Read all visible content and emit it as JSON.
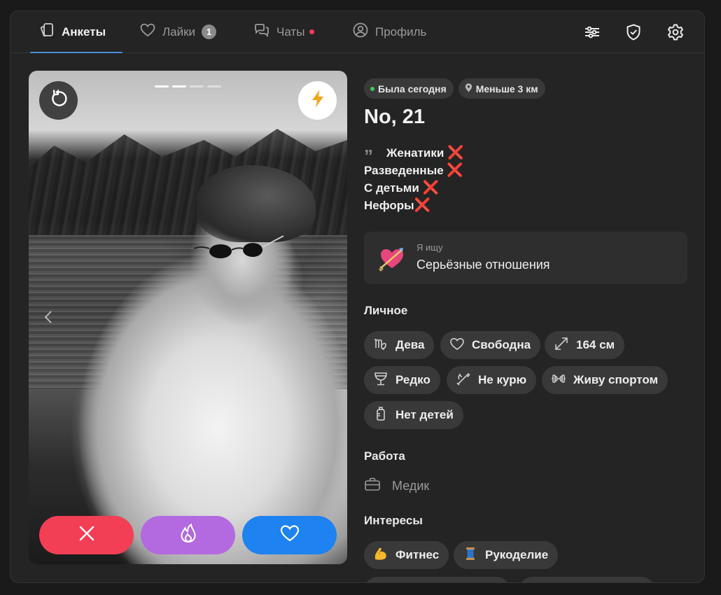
{
  "nav": {
    "tabs": [
      {
        "label": "Анкеты",
        "icon": "cards-icon",
        "active": true
      },
      {
        "label": "Лайки",
        "icon": "heart-icon",
        "badge": "1"
      },
      {
        "label": "Чаты",
        "icon": "chat-icon",
        "unread_dot": true
      },
      {
        "label": "Профиль",
        "icon": "user-icon"
      }
    ],
    "right_icons": [
      "filters-icon",
      "shield-check-icon",
      "gear-icon"
    ]
  },
  "photo": {
    "progress": {
      "total": 4,
      "current": 2
    },
    "undo_icon": "undo-icon",
    "boost_icon": "lightning-icon",
    "actions": [
      "close-icon",
      "flame-icon",
      "heart-icon"
    ]
  },
  "profile": {
    "status": "Была сегодня",
    "distance": "Меньше 3 км",
    "name": "No, 21",
    "bio": [
      "Женатики",
      "Разведенные",
      "С детьми",
      "Нефоры"
    ],
    "seeking_label": "Я ищу",
    "seeking_value": "Серьёзные отношения",
    "personal_title": "Личное",
    "personal": [
      {
        "label": "Дева",
        "icon": "virgo-icon"
      },
      {
        "label": "Свободна",
        "icon": "heart-outline-icon"
      },
      {
        "label": "164 см",
        "icon": "height-icon"
      },
      {
        "label": "Редко",
        "icon": "wine-glass-icon"
      },
      {
        "label": "Не курю",
        "icon": "no-smoking-icon"
      },
      {
        "label": "Живу спортом",
        "icon": "dumbbell-icon"
      },
      {
        "label": "Нет детей",
        "icon": "baby-bottle-icon"
      }
    ],
    "work_title": "Работа",
    "work": "Медик",
    "interests_title": "Интересы",
    "interests": [
      {
        "label": "Фитнес",
        "icon": "flexed-biceps-icon"
      },
      {
        "label": "Рукоделие",
        "icon": "thread-spool-icon"
      }
    ]
  },
  "colors": {
    "dislike": "#f23f56",
    "super": "#b36ae0",
    "like": "#1e82f0",
    "accent_tab": "#4a8fd8",
    "red_x": "#f0325a",
    "online": "#3ec75a"
  }
}
